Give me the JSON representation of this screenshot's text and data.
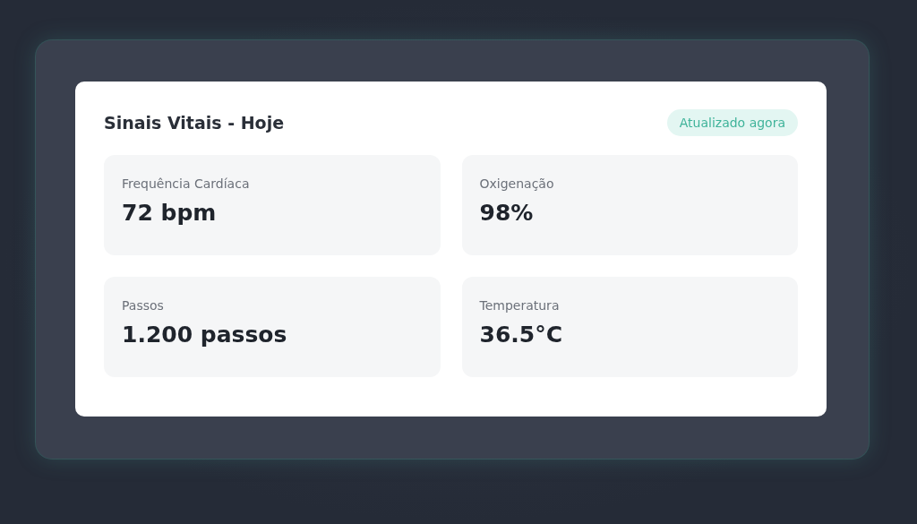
{
  "card": {
    "title": "Sinais Vitais - Hoje",
    "status_badge": "Atualizado agora"
  },
  "metrics": [
    {
      "label": "Frequência Cardíaca",
      "value": "72 bpm"
    },
    {
      "label": "Oxigenação",
      "value": "98%"
    },
    {
      "label": "Passos",
      "value": "1.200 passos"
    },
    {
      "label": "Temperatura",
      "value": "36.5°C"
    }
  ]
}
